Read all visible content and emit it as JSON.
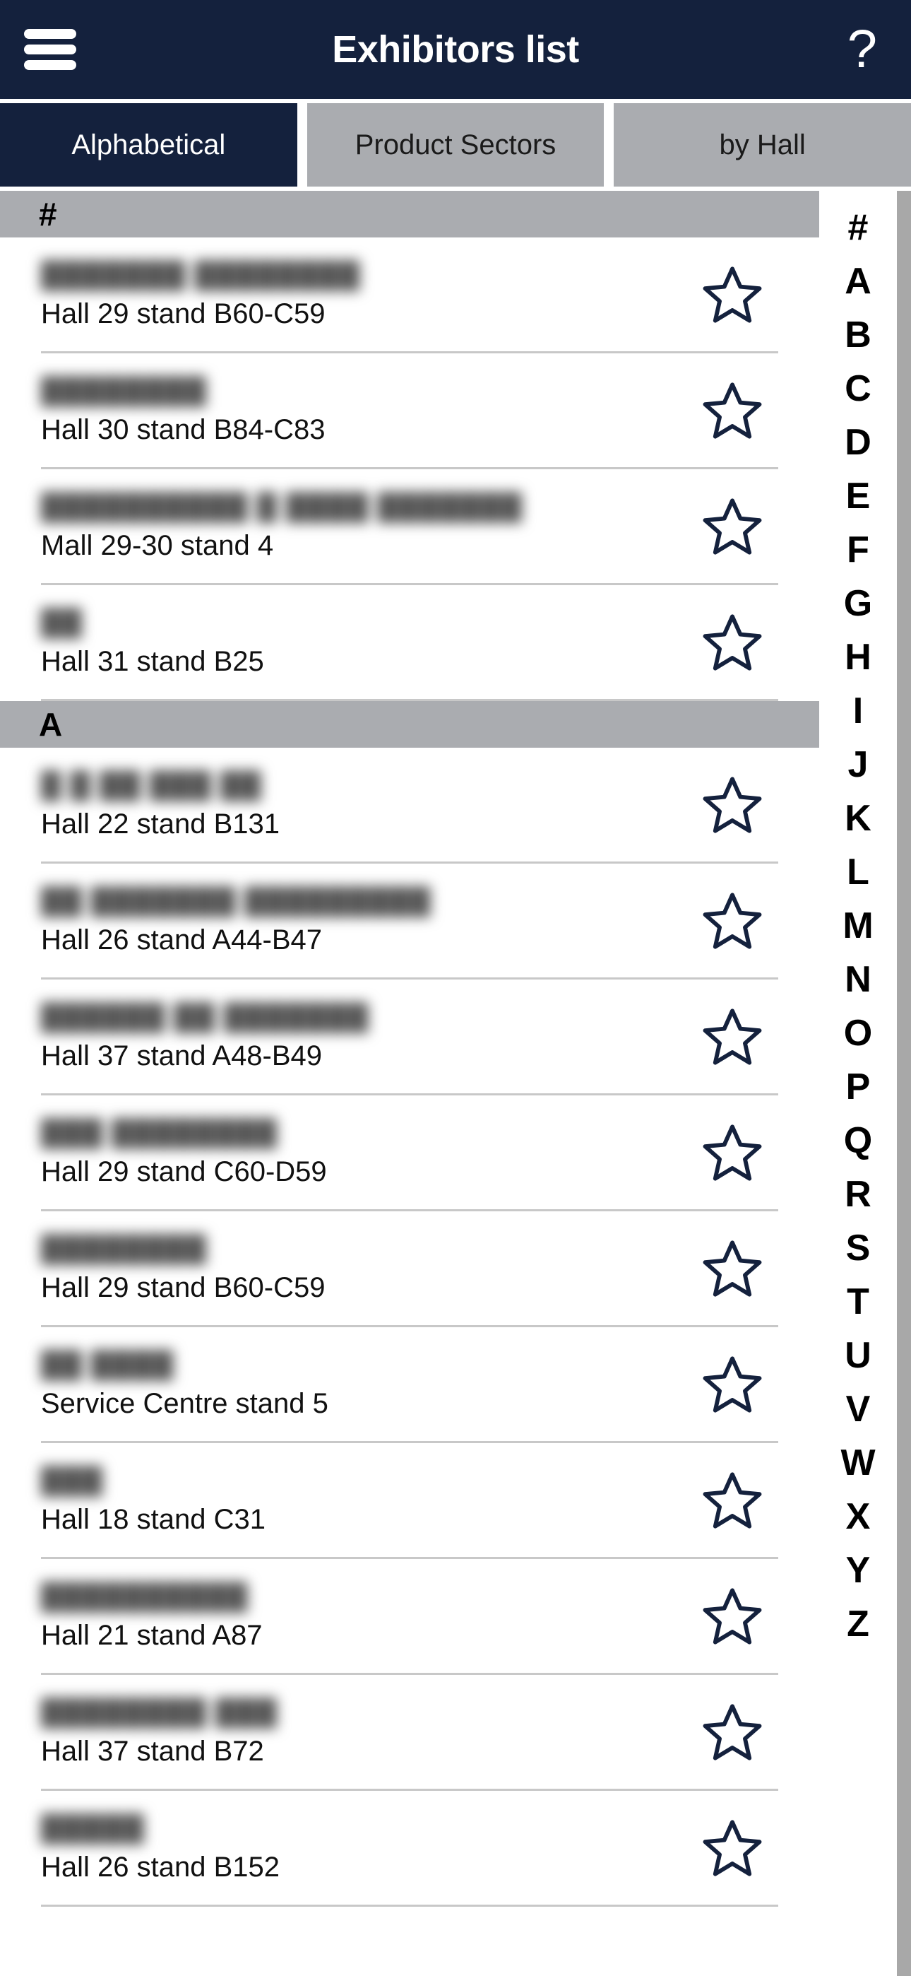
{
  "appbar": {
    "title": "Exhibitors list",
    "menu_icon": "hamburger-menu-icon",
    "help_icon": "?"
  },
  "tabs": [
    {
      "label": "Alphabetical",
      "active": true
    },
    {
      "label": "Product Sectors",
      "active": false
    },
    {
      "label": "by Hall",
      "active": false
    }
  ],
  "sections": [
    {
      "header": "#",
      "rows": [
        {
          "name": "███████ ████████",
          "location": "Hall 29 stand B60-C59",
          "star": "star-outline-icon"
        },
        {
          "name": "████████",
          "location": "Hall 30 stand B84-C83",
          "star": "star-outline-icon"
        },
        {
          "name": "██████████ █ ████ ███████",
          "location": "Mall 29-30 stand 4",
          "star": "star-outline-icon"
        },
        {
          "name": "██",
          "location": "Hall 31 stand B25",
          "star": "star-outline-icon"
        }
      ]
    },
    {
      "header": "A",
      "rows": [
        {
          "name": "█ █ ██ ███ ██",
          "location": "Hall 22 stand B131",
          "star": "star-outline-icon"
        },
        {
          "name": "██ ███████ █████████",
          "location": "Hall 26 stand A44-B47",
          "star": "star-outline-icon"
        },
        {
          "name": "██████ ██ ███████",
          "location": "Hall 37 stand A48-B49",
          "star": "star-outline-icon"
        },
        {
          "name": "███ ████████",
          "location": "Hall 29 stand C60-D59",
          "star": "star-outline-icon"
        },
        {
          "name": "████████",
          "location": "Hall 29 stand B60-C59",
          "star": "star-outline-icon"
        },
        {
          "name": "██ ████",
          "location": "Service Centre stand 5",
          "star": "star-outline-icon"
        },
        {
          "name": "███",
          "location": "Hall 18 stand C31",
          "star": "star-outline-icon"
        },
        {
          "name": "██████████",
          "location": "Hall 21 stand A87",
          "star": "star-outline-icon"
        },
        {
          "name": "████████ ███",
          "location": "Hall 37 stand B72",
          "star": "star-outline-icon"
        },
        {
          "name": "█████",
          "location": "Hall 26 stand B152",
          "star": "star-outline-icon"
        }
      ]
    }
  ],
  "alphabet_index": {
    "letters": [
      "#",
      "A",
      "B",
      "C",
      "D",
      "E",
      "F",
      "G",
      "H",
      "I",
      "J",
      "K",
      "L",
      "M",
      "N",
      "O",
      "P",
      "Q",
      "R",
      "S",
      "T",
      "U",
      "V",
      "W",
      "X",
      "Y",
      "Z"
    ]
  },
  "colors": {
    "brand_navy": "#14213d",
    "tab_inactive": "#aaacb0",
    "section_header": "#aaacb0",
    "divider": "#c8c8c8",
    "scrollbar": "#a8a8a8"
  }
}
